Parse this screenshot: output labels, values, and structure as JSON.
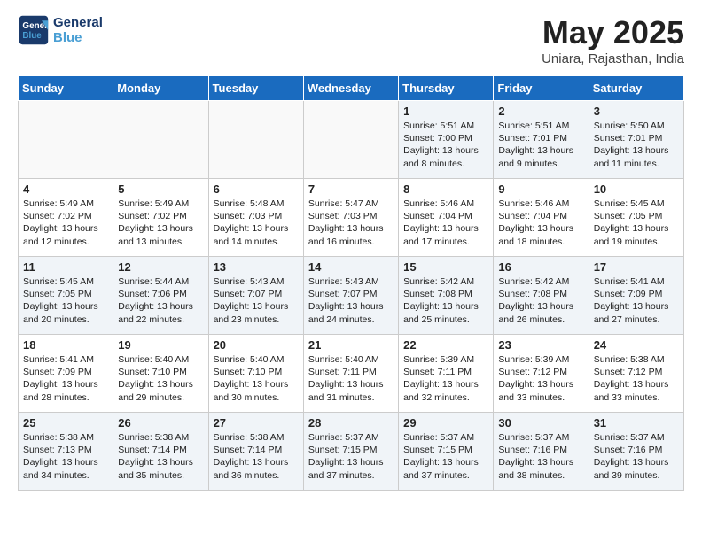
{
  "header": {
    "logo_line1": "General",
    "logo_line2": "Blue",
    "title": "May 2025",
    "location": "Uniara, Rajasthan, India"
  },
  "weekdays": [
    "Sunday",
    "Monday",
    "Tuesday",
    "Wednesday",
    "Thursday",
    "Friday",
    "Saturday"
  ],
  "weeks": [
    [
      {
        "day": "",
        "info": ""
      },
      {
        "day": "",
        "info": ""
      },
      {
        "day": "",
        "info": ""
      },
      {
        "day": "",
        "info": ""
      },
      {
        "day": "1",
        "info": "Sunrise: 5:51 AM\nSunset: 7:00 PM\nDaylight: 13 hours\nand 8 minutes."
      },
      {
        "day": "2",
        "info": "Sunrise: 5:51 AM\nSunset: 7:01 PM\nDaylight: 13 hours\nand 9 minutes."
      },
      {
        "day": "3",
        "info": "Sunrise: 5:50 AM\nSunset: 7:01 PM\nDaylight: 13 hours\nand 11 minutes."
      }
    ],
    [
      {
        "day": "4",
        "info": "Sunrise: 5:49 AM\nSunset: 7:02 PM\nDaylight: 13 hours\nand 12 minutes."
      },
      {
        "day": "5",
        "info": "Sunrise: 5:49 AM\nSunset: 7:02 PM\nDaylight: 13 hours\nand 13 minutes."
      },
      {
        "day": "6",
        "info": "Sunrise: 5:48 AM\nSunset: 7:03 PM\nDaylight: 13 hours\nand 14 minutes."
      },
      {
        "day": "7",
        "info": "Sunrise: 5:47 AM\nSunset: 7:03 PM\nDaylight: 13 hours\nand 16 minutes."
      },
      {
        "day": "8",
        "info": "Sunrise: 5:46 AM\nSunset: 7:04 PM\nDaylight: 13 hours\nand 17 minutes."
      },
      {
        "day": "9",
        "info": "Sunrise: 5:46 AM\nSunset: 7:04 PM\nDaylight: 13 hours\nand 18 minutes."
      },
      {
        "day": "10",
        "info": "Sunrise: 5:45 AM\nSunset: 7:05 PM\nDaylight: 13 hours\nand 19 minutes."
      }
    ],
    [
      {
        "day": "11",
        "info": "Sunrise: 5:45 AM\nSunset: 7:05 PM\nDaylight: 13 hours\nand 20 minutes."
      },
      {
        "day": "12",
        "info": "Sunrise: 5:44 AM\nSunset: 7:06 PM\nDaylight: 13 hours\nand 22 minutes."
      },
      {
        "day": "13",
        "info": "Sunrise: 5:43 AM\nSunset: 7:07 PM\nDaylight: 13 hours\nand 23 minutes."
      },
      {
        "day": "14",
        "info": "Sunrise: 5:43 AM\nSunset: 7:07 PM\nDaylight: 13 hours\nand 24 minutes."
      },
      {
        "day": "15",
        "info": "Sunrise: 5:42 AM\nSunset: 7:08 PM\nDaylight: 13 hours\nand 25 minutes."
      },
      {
        "day": "16",
        "info": "Sunrise: 5:42 AM\nSunset: 7:08 PM\nDaylight: 13 hours\nand 26 minutes."
      },
      {
        "day": "17",
        "info": "Sunrise: 5:41 AM\nSunset: 7:09 PM\nDaylight: 13 hours\nand 27 minutes."
      }
    ],
    [
      {
        "day": "18",
        "info": "Sunrise: 5:41 AM\nSunset: 7:09 PM\nDaylight: 13 hours\nand 28 minutes."
      },
      {
        "day": "19",
        "info": "Sunrise: 5:40 AM\nSunset: 7:10 PM\nDaylight: 13 hours\nand 29 minutes."
      },
      {
        "day": "20",
        "info": "Sunrise: 5:40 AM\nSunset: 7:10 PM\nDaylight: 13 hours\nand 30 minutes."
      },
      {
        "day": "21",
        "info": "Sunrise: 5:40 AM\nSunset: 7:11 PM\nDaylight: 13 hours\nand 31 minutes."
      },
      {
        "day": "22",
        "info": "Sunrise: 5:39 AM\nSunset: 7:11 PM\nDaylight: 13 hours\nand 32 minutes."
      },
      {
        "day": "23",
        "info": "Sunrise: 5:39 AM\nSunset: 7:12 PM\nDaylight: 13 hours\nand 33 minutes."
      },
      {
        "day": "24",
        "info": "Sunrise: 5:38 AM\nSunset: 7:12 PM\nDaylight: 13 hours\nand 33 minutes."
      }
    ],
    [
      {
        "day": "25",
        "info": "Sunrise: 5:38 AM\nSunset: 7:13 PM\nDaylight: 13 hours\nand 34 minutes."
      },
      {
        "day": "26",
        "info": "Sunrise: 5:38 AM\nSunset: 7:14 PM\nDaylight: 13 hours\nand 35 minutes."
      },
      {
        "day": "27",
        "info": "Sunrise: 5:38 AM\nSunset: 7:14 PM\nDaylight: 13 hours\nand 36 minutes."
      },
      {
        "day": "28",
        "info": "Sunrise: 5:37 AM\nSunset: 7:15 PM\nDaylight: 13 hours\nand 37 minutes."
      },
      {
        "day": "29",
        "info": "Sunrise: 5:37 AM\nSunset: 7:15 PM\nDaylight: 13 hours\nand 37 minutes."
      },
      {
        "day": "30",
        "info": "Sunrise: 5:37 AM\nSunset: 7:16 PM\nDaylight: 13 hours\nand 38 minutes."
      },
      {
        "day": "31",
        "info": "Sunrise: 5:37 AM\nSunset: 7:16 PM\nDaylight: 13 hours\nand 39 minutes."
      }
    ]
  ]
}
